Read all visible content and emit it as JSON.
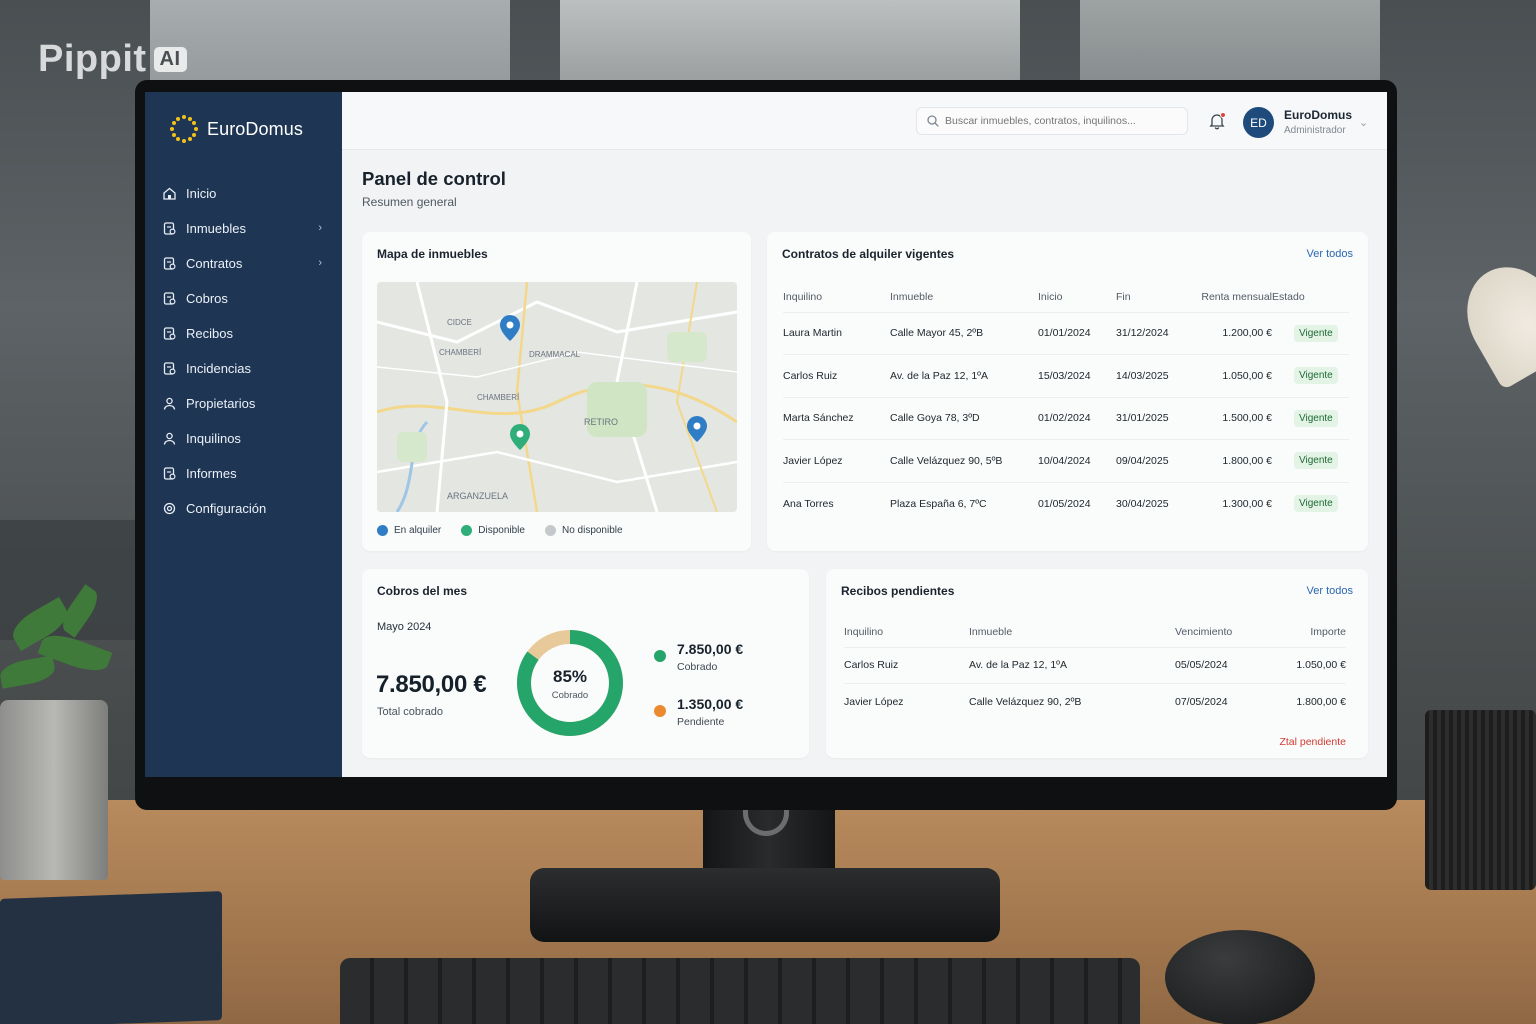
{
  "watermark": {
    "brand": "Pippit",
    "badge": "AI"
  },
  "app": {
    "name": "EuroDomus",
    "colors": {
      "sidebar": "#1e3554",
      "accent": "#2b67b1",
      "success": "#26a56a",
      "pending": "#ec8a2f",
      "logo_stars": "#f2c21b"
    }
  },
  "sidebar": {
    "items": [
      {
        "label": "Inicio",
        "icon": "home-icon",
        "chevron": false
      },
      {
        "label": "Inmuebles",
        "icon": "building-icon",
        "chevron": true
      },
      {
        "label": "Contratos",
        "icon": "contract-icon",
        "chevron": true
      },
      {
        "label": "Cobros",
        "icon": "payment-icon",
        "chevron": false
      },
      {
        "label": "Recibos",
        "icon": "receipt-icon",
        "chevron": false
      },
      {
        "label": "Incidencias",
        "icon": "incident-icon",
        "chevron": false
      },
      {
        "label": "Propietarios",
        "icon": "owner-icon",
        "chevron": false
      },
      {
        "label": "Inquilinos",
        "icon": "tenant-icon",
        "chevron": false
      },
      {
        "label": "Informes",
        "icon": "report-icon",
        "chevron": false
      },
      {
        "label": "Configuración",
        "icon": "settings-icon",
        "chevron": false
      }
    ]
  },
  "header": {
    "search_placeholder": "Buscar inmuebles, contratos, inquilinos...",
    "user": {
      "initials": "ED",
      "name": "EuroDomus",
      "role": "Administrador"
    }
  },
  "page": {
    "title": "Panel de control",
    "subtitle": "Resumen general"
  },
  "map_card": {
    "title": "Mapa de inmuebles",
    "labels": [
      "RETIRO",
      "ARGANZUELA",
      "CHAMBERÍ",
      "DRAMMACAL",
      "CIDCE",
      "CHAMBERÍ"
    ],
    "legend": [
      {
        "label": "En alquiler",
        "color": "#2f7dc4"
      },
      {
        "label": "Disponible",
        "color": "#2fae7a"
      },
      {
        "label": "No disponible",
        "color": "#c6c9cc"
      }
    ]
  },
  "contracts": {
    "title": "Contratos de alquiler vigentes",
    "link": "Ver todos",
    "columns": [
      "Inquilino",
      "Inmueble",
      "Inicio",
      "Fin",
      "Renta mensual",
      "Estado"
    ],
    "rows": [
      {
        "tenant": "Laura Martin",
        "property": "Calle Mayor 45, 2ºB",
        "start": "01/01/2024",
        "end": "31/12/2024",
        "rent": "1.200,00 €",
        "status": "Vigente"
      },
      {
        "tenant": "Carlos Ruiz",
        "property": "Av. de la Paz 12, 1ºA",
        "start": "15/03/2024",
        "end": "14/03/2025",
        "rent": "1.050,00 €",
        "status": "Vigente"
      },
      {
        "tenant": "Marta Sánchez",
        "property": "Calle Goya 78, 3ºD",
        "start": "01/02/2024",
        "end": "31/01/2025",
        "rent": "1.500,00 €",
        "status": "Vigente"
      },
      {
        "tenant": "Javier López",
        "property": "Calle Velázquez 90, 5ºB",
        "start": "10/04/2024",
        "end": "09/04/2025",
        "rent": "1.800,00 €",
        "status": "Vigente"
      },
      {
        "tenant": "Ana Torres",
        "property": "Plaza España 6, 7ºC",
        "start": "01/05/2024",
        "end": "30/04/2025",
        "rent": "1.300,00 €",
        "status": "Vigente"
      }
    ]
  },
  "cobros": {
    "title": "Cobros del mes",
    "month": "Mayo 2024",
    "total": "7.850,00 €",
    "total_label": "Total cobrado",
    "percent_label": "85%",
    "percent_value": 0.85,
    "percent_caption": "Cobrado",
    "collected": {
      "amount": "7.850,00 €",
      "label": "Cobrado"
    },
    "pending": {
      "amount": "1.350,00 €",
      "label": "Pendiente"
    }
  },
  "receipts": {
    "title": "Recibos pendientes",
    "link": "Ver todos",
    "columns": [
      "Inquilino",
      "Inmueble",
      "Vencimiento",
      "Importe"
    ],
    "rows": [
      {
        "tenant": "Carlos Ruiz",
        "property": "Av. de la Paz 12, 1ºA",
        "due": "05/05/2024",
        "amount": "1.050,00 €"
      },
      {
        "tenant": "Javier López",
        "property": "Calle Velázquez 90, 2ºB",
        "due": "07/05/2024",
        "amount": "1.800,00 €"
      }
    ],
    "footer": "Ztal pendiente"
  }
}
